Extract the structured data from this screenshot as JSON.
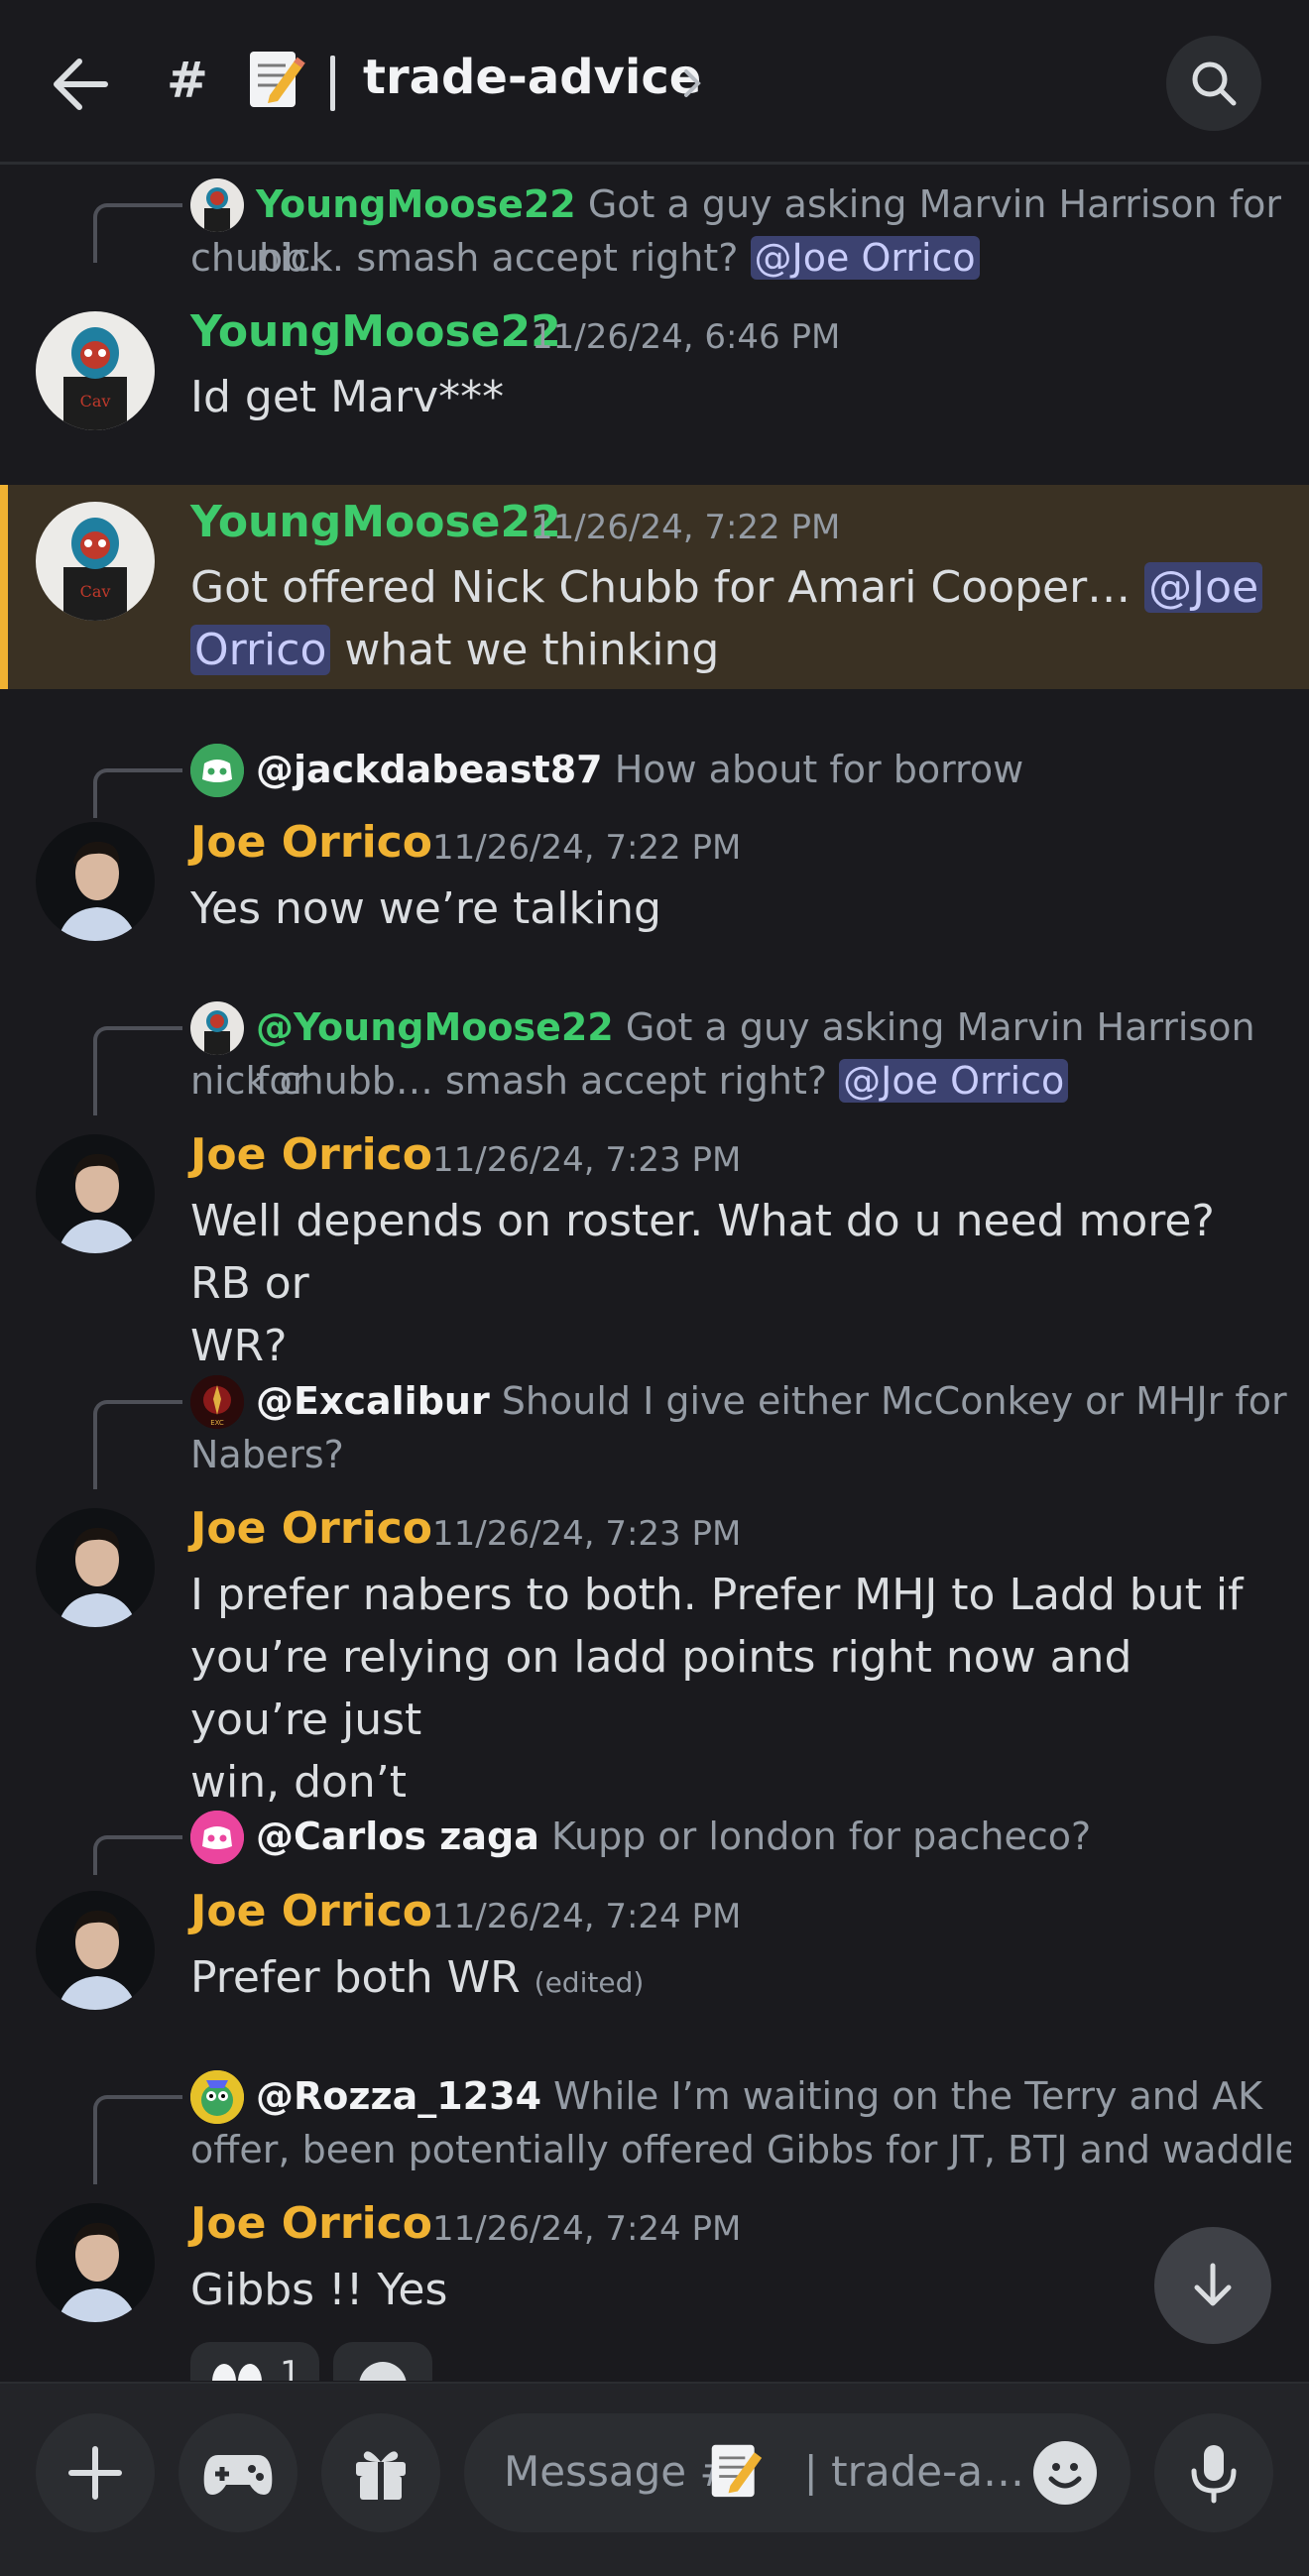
{
  "header": {
    "hash": "#",
    "channel_name": "trade-advice",
    "emoji_icon": "memo-emoji-icon"
  },
  "messages": [
    {
      "reply": {
        "name": "YoungMoose22",
        "text_line1": "Got a guy asking Marvin Harrison for nick",
        "text_line2": "chubb… smash accept right?",
        "mention": "@Joe Orrico"
      },
      "author": "YoungMoose22",
      "timestamp": "11/26/24, 6:46 PM",
      "body": "Id get Marv***"
    },
    {
      "author": "YoungMoose22",
      "timestamp": "11/26/24, 7:22 PM",
      "body_line1": "Got offered Nick Chubb for Amari Cooper…",
      "mention_part1": "@Joe",
      "mention_part2": "Orrico",
      "body_line2_rest": "what we thinking",
      "highlighted": true
    },
    {
      "reply": {
        "name": "@jackdabeast87",
        "text": "How about for borrow"
      },
      "author": "Joe Orrico",
      "timestamp": "11/26/24, 7:22 PM",
      "body": "Yes now we’re talking"
    },
    {
      "reply": {
        "name": "@YoungMoose22",
        "text_line1": "Got a guy asking Marvin Harrison for",
        "text_line2": "nick chubb… smash accept right?",
        "mention": "@Joe Orrico"
      },
      "author": "Joe Orrico",
      "timestamp": "11/26/24, 7:23 PM",
      "body_line1": "Well depends on roster. What do u need more? RB or",
      "body_line2": "WR?"
    },
    {
      "reply": {
        "name": "@Excalibur",
        "text_line1": "Should I give either McConkey or MHJr for",
        "text_line2": "Nabers?"
      },
      "author": "Joe Orrico",
      "timestamp": "11/26/24, 7:23 PM",
      "body_line1": "I prefer nabers to both. Prefer MHJ to Ladd but if",
      "body_line2": "you’re relying on ladd points right now and you’re just",
      "body_line3": "win, don’t"
    },
    {
      "reply": {
        "name": "@Carlos zaga",
        "text": "Kupp or london for pacheco?"
      },
      "author": "Joe Orrico",
      "timestamp": "11/26/24, 7:24 PM",
      "body": "Prefer both WR",
      "edited": "(edited)"
    },
    {
      "reply": {
        "name": "@Rozza_1234",
        "text_line1": "While I’m waiting on the Terry and AK",
        "text_line2": "offer, been potentially offered Gibbs for JT, BTJ and waddle…"
      },
      "author": "Joe Orrico",
      "timestamp": "11/26/24, 7:24 PM",
      "body": "Gibbs !! Yes",
      "reaction_count": "1"
    }
  ],
  "composer": {
    "placeholder_prefix": "Message #",
    "placeholder_suffix": "| trade-a…"
  },
  "colors": {
    "background": "#1a1a1e",
    "green_name": "#3ecb6c",
    "joe_name": "#f0b232",
    "mention_bg": "#3c4270",
    "highlight_bg": "#3a3123"
  }
}
